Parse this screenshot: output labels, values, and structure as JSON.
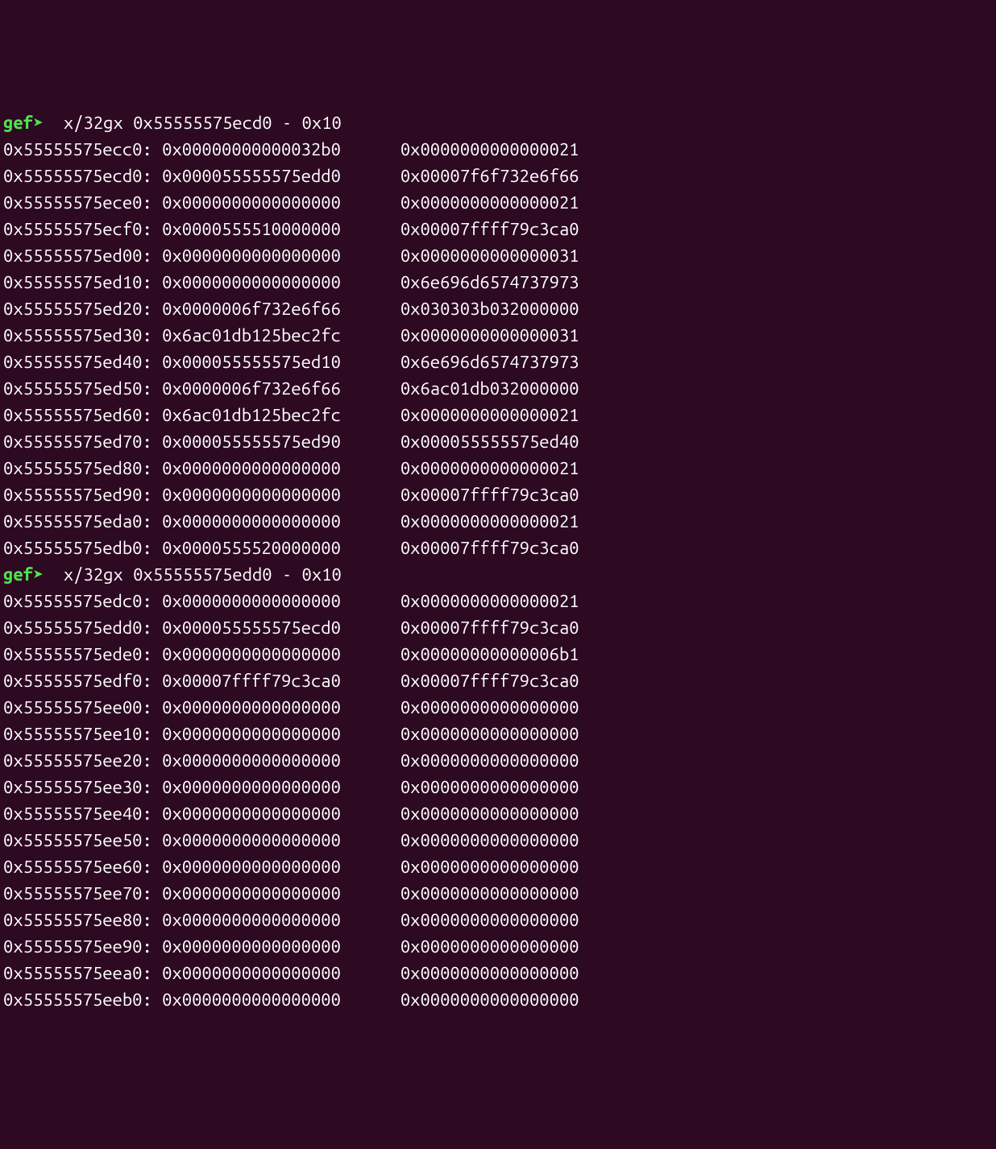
{
  "prompt_label": "gef",
  "prompt_arrow": "➤ ",
  "blocks": [
    {
      "command": "x/32gx 0x55555575ecd0 - 0x10",
      "rows": [
        {
          "addr": "0x55555575ecc0:",
          "v1": "0x00000000000032b0",
          "v2": "0x0000000000000021"
        },
        {
          "addr": "0x55555575ecd0:",
          "v1": "0x000055555575edd0",
          "v2": "0x00007f6f732e6f66"
        },
        {
          "addr": "0x55555575ece0:",
          "v1": "0x0000000000000000",
          "v2": "0x0000000000000021"
        },
        {
          "addr": "0x55555575ecf0:",
          "v1": "0x0000555510000000",
          "v2": "0x00007ffff79c3ca0"
        },
        {
          "addr": "0x55555575ed00:",
          "v1": "0x0000000000000000",
          "v2": "0x0000000000000031"
        },
        {
          "addr": "0x55555575ed10:",
          "v1": "0x0000000000000000",
          "v2": "0x6e696d6574737973"
        },
        {
          "addr": "0x55555575ed20:",
          "v1": "0x0000006f732e6f66",
          "v2": "0x030303b032000000"
        },
        {
          "addr": "0x55555575ed30:",
          "v1": "0x6ac01db125bec2fc",
          "v2": "0x0000000000000031"
        },
        {
          "addr": "0x55555575ed40:",
          "v1": "0x000055555575ed10",
          "v2": "0x6e696d6574737973"
        },
        {
          "addr": "0x55555575ed50:",
          "v1": "0x0000006f732e6f66",
          "v2": "0x6ac01db032000000"
        },
        {
          "addr": "0x55555575ed60:",
          "v1": "0x6ac01db125bec2fc",
          "v2": "0x0000000000000021"
        },
        {
          "addr": "0x55555575ed70:",
          "v1": "0x000055555575ed90",
          "v2": "0x000055555575ed40"
        },
        {
          "addr": "0x55555575ed80:",
          "v1": "0x0000000000000000",
          "v2": "0x0000000000000021"
        },
        {
          "addr": "0x55555575ed90:",
          "v1": "0x0000000000000000",
          "v2": "0x00007ffff79c3ca0"
        },
        {
          "addr": "0x55555575eda0:",
          "v1": "0x0000000000000000",
          "v2": "0x0000000000000021"
        },
        {
          "addr": "0x55555575edb0:",
          "v1": "0x0000555520000000",
          "v2": "0x00007ffff79c3ca0"
        }
      ]
    },
    {
      "command": "x/32gx 0x55555575edd0 - 0x10",
      "rows": [
        {
          "addr": "0x55555575edc0:",
          "v1": "0x0000000000000000",
          "v2": "0x0000000000000021"
        },
        {
          "addr": "0x55555575edd0:",
          "v1": "0x000055555575ecd0",
          "v2": "0x00007ffff79c3ca0"
        },
        {
          "addr": "0x55555575ede0:",
          "v1": "0x0000000000000000",
          "v2": "0x00000000000006b1"
        },
        {
          "addr": "0x55555575edf0:",
          "v1": "0x00007ffff79c3ca0",
          "v2": "0x00007ffff79c3ca0"
        },
        {
          "addr": "0x55555575ee00:",
          "v1": "0x0000000000000000",
          "v2": "0x0000000000000000"
        },
        {
          "addr": "0x55555575ee10:",
          "v1": "0x0000000000000000",
          "v2": "0x0000000000000000"
        },
        {
          "addr": "0x55555575ee20:",
          "v1": "0x0000000000000000",
          "v2": "0x0000000000000000"
        },
        {
          "addr": "0x55555575ee30:",
          "v1": "0x0000000000000000",
          "v2": "0x0000000000000000"
        },
        {
          "addr": "0x55555575ee40:",
          "v1": "0x0000000000000000",
          "v2": "0x0000000000000000"
        },
        {
          "addr": "0x55555575ee50:",
          "v1": "0x0000000000000000",
          "v2": "0x0000000000000000"
        },
        {
          "addr": "0x55555575ee60:",
          "v1": "0x0000000000000000",
          "v2": "0x0000000000000000"
        },
        {
          "addr": "0x55555575ee70:",
          "v1": "0x0000000000000000",
          "v2": "0x0000000000000000"
        },
        {
          "addr": "0x55555575ee80:",
          "v1": "0x0000000000000000",
          "v2": "0x0000000000000000"
        },
        {
          "addr": "0x55555575ee90:",
          "v1": "0x0000000000000000",
          "v2": "0x0000000000000000"
        },
        {
          "addr": "0x55555575eea0:",
          "v1": "0x0000000000000000",
          "v2": "0x0000000000000000"
        },
        {
          "addr": "0x55555575eeb0:",
          "v1": "0x0000000000000000",
          "v2": "0x0000000000000000"
        }
      ]
    }
  ]
}
